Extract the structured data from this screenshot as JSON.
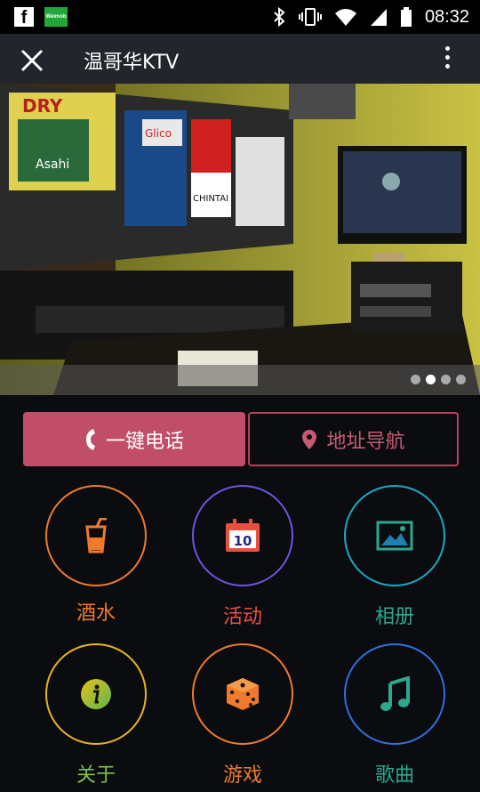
{
  "status_bar": {
    "time": "08:32",
    "left_icons": [
      "facebook-icon",
      "weimob-icon"
    ],
    "weimob_text": "Weimob",
    "fb_text": "f",
    "right_icons": [
      "bluetooth-icon",
      "vibrate-icon",
      "wifi-icon",
      "signal-icon",
      "battery-icon"
    ]
  },
  "title_bar": {
    "title": "温哥华KTV",
    "close_icon": "close-icon",
    "more_icon": "more-vertical-icon"
  },
  "banner": {
    "slide_count": 4,
    "active_slide": 2,
    "poster_texts": [
      "DRY",
      "Asahi",
      "Glico",
      "CHINTAI"
    ]
  },
  "actions": {
    "call_label": "一键电话",
    "call_icon": "phone-icon",
    "nav_label": "地址导航",
    "nav_icon": "map-pin-icon"
  },
  "grid": [
    {
      "label": "酒水",
      "icon": "drink-icon",
      "color": "#f07a2c"
    },
    {
      "label": "活动",
      "icon": "calendar-icon",
      "color": "#6a55e0",
      "label_color": "#e8503e",
      "calendar_day": "10"
    },
    {
      "label": "相册",
      "icon": "image-icon",
      "color": "#1fa6c4",
      "label_color": "#2ca88e"
    },
    {
      "label": "关于",
      "icon": "info-icon",
      "color": "#e6b51c",
      "label_color": "#7cc24a"
    },
    {
      "label": "游戏",
      "icon": "dice-icon",
      "color": "#f07a2c"
    },
    {
      "label": "歌曲",
      "icon": "music-icon",
      "color": "#2f6fe0",
      "label_color": "#2ca88e"
    }
  ],
  "colors": {
    "call_button": "#c14e68",
    "nav_border": "#b8405a",
    "background": "#0b0c10",
    "title_bar": "#22252b"
  }
}
